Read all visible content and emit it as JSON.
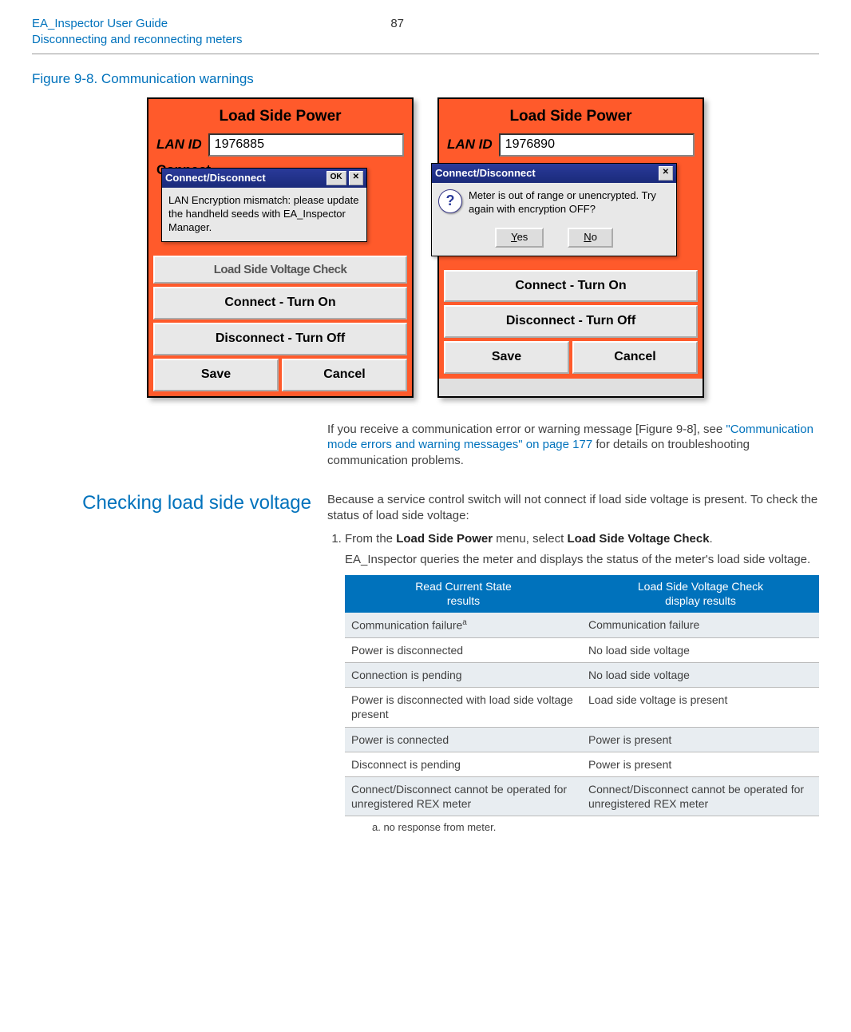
{
  "header": {
    "line1": "EA_Inspector User Guide",
    "line2": "Disconnecting and reconnecting meters",
    "page_number": "87"
  },
  "figure": {
    "caption": "Figure 9-8. Communication warnings",
    "shot_common": {
      "title": "Load Side Power",
      "lan_label": "LAN ID",
      "connect_text": "Connect...",
      "obscured_btn": "Load Side Voltage Check",
      "btn_connect": "Connect - Turn On",
      "btn_disconnect": "Disconnect - Turn Off",
      "btn_save": "Save",
      "btn_cancel": "Cancel"
    },
    "shot_left": {
      "lan_value": "1976885",
      "modal_title": "Connect/Disconnect",
      "modal_ok": "OK",
      "modal_msg": "LAN Encryption mismatch: please update the handheld seeds with EA_Inspector Manager."
    },
    "shot_right": {
      "lan_value": "1976890",
      "modal_title": "Connect/Disconnect",
      "modal_msg": "Meter is out of range or unencrypted. Try again with encryption OFF?",
      "yes_label": "Yes",
      "no_label": "No"
    }
  },
  "after_figure": {
    "before_link": "If you receive a communication error or warning message [Figure 9-8], see ",
    "link_text": "\"Communication mode errors and warning messages\" on page 177",
    "after_link": " for details on troubleshooting communication problems."
  },
  "section": {
    "heading": "Checking load side voltage",
    "intro": "Because a service control switch will not connect if load side voltage is present. To check the status of load side voltage:",
    "step1_pre": "From the ",
    "step1_b1": "Load Side Power",
    "step1_mid": " menu, select ",
    "step1_b2": "Load Side Voltage Check",
    "step1_post": ".",
    "step1_para": "EA_Inspector queries the meter and displays the status of the meter's load side voltage.",
    "table": {
      "th1a": "Read Current State",
      "th1b": "results",
      "th2a": "Load Side Voltage Check",
      "th2b": "display results",
      "rows": [
        {
          "c1": "Communication failure",
          "c1_sup": "a",
          "c2": "Communication failure"
        },
        {
          "c1": "Power is disconnected",
          "c2": "No load side voltage"
        },
        {
          "c1": "Connection is pending",
          "c2": "No load side voltage"
        },
        {
          "c1": "Power is disconnected with load side voltage present",
          "c2": "Load side voltage is present"
        },
        {
          "c1": "Power is connected",
          "c2": "Power is present"
        },
        {
          "c1": "Disconnect is pending",
          "c2": "Power is present"
        },
        {
          "c1": "Connect/Disconnect cannot be operated for unregistered REX meter",
          "c2": "Connect/Disconnect cannot be operated for unregistered REX meter"
        }
      ],
      "footnote": "a.  no response from meter."
    }
  }
}
